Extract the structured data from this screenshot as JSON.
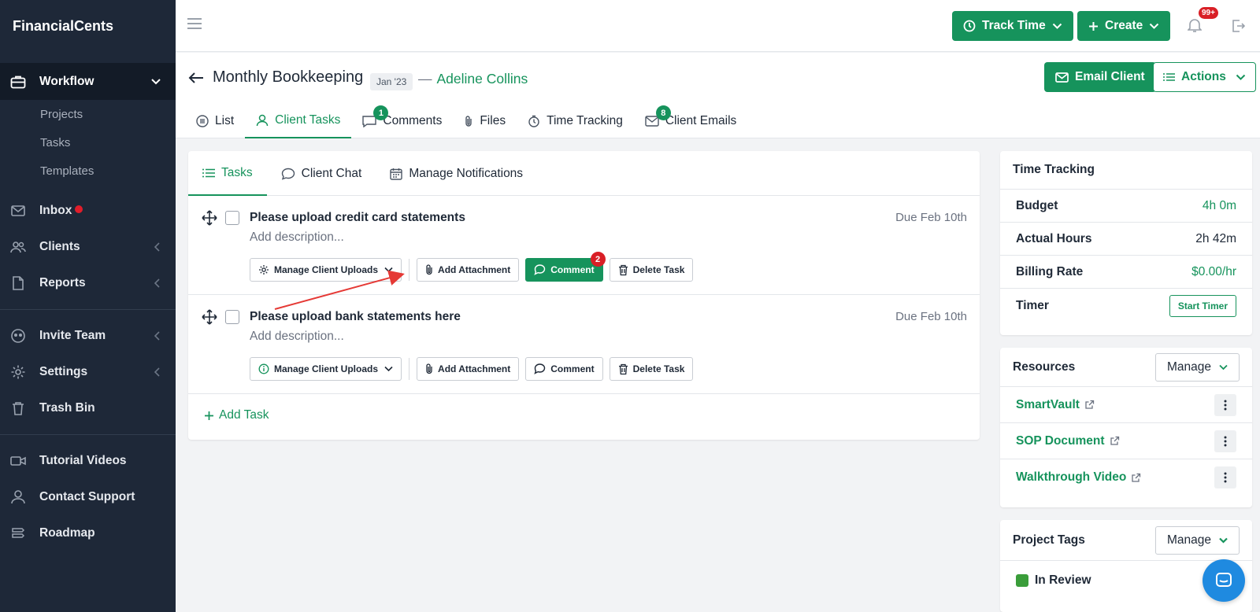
{
  "brand": "FinancialCents",
  "sidebar": {
    "workflow": {
      "label": "Workflow",
      "items": [
        "Projects",
        "Tasks",
        "Templates"
      ]
    },
    "inbox": "Inbox",
    "clients": "Clients",
    "reports": "Reports",
    "invite_team": "Invite Team",
    "settings": "Settings",
    "trash_bin": "Trash Bin",
    "tutorial_videos": "Tutorial Videos",
    "contact_support": "Contact Support",
    "roadmap": "Roadmap"
  },
  "topbar": {
    "track_time": "Track Time",
    "create": "Create",
    "notifications_badge": "99+"
  },
  "project": {
    "title": "Monthly Bookkeeping",
    "period": "Jan '23",
    "dash": "—",
    "client": "Adeline Collins",
    "email_client": "Email Client",
    "actions": "Actions"
  },
  "tabs": [
    {
      "label": "List"
    },
    {
      "label": "Client Tasks"
    },
    {
      "label": "Comments",
      "badge": "1"
    },
    {
      "label": "Files"
    },
    {
      "label": "Time Tracking"
    },
    {
      "label": "Client Emails",
      "badge": "8"
    }
  ],
  "subtabs": [
    "Tasks",
    "Client Chat",
    "Manage Notifications"
  ],
  "tasks": [
    {
      "name": "Please upload credit card statements",
      "description": "Add description...",
      "due": "Due Feb 10th",
      "manage_uploads": "Manage Client Uploads",
      "add_attachment": "Add Attachment",
      "comment": "Comment",
      "comment_badge": "2",
      "delete": "Delete Task"
    },
    {
      "name": "Please upload bank statements here",
      "description": "Add description...",
      "due": "Due Feb 10th",
      "manage_uploads": "Manage Client Uploads",
      "add_attachment": "Add Attachment",
      "comment": "Comment",
      "delete": "Delete Task"
    }
  ],
  "add_task": "Add Task",
  "time_tracking": {
    "title": "Time Tracking",
    "budget_label": "Budget",
    "budget_value": "4h 0m",
    "actual_label": "Actual Hours",
    "actual_value": "2h 42m",
    "rate_label": "Billing Rate",
    "rate_value": "$0.00/hr",
    "timer_label": "Timer",
    "start_timer": "Start Timer"
  },
  "resources": {
    "title": "Resources",
    "manage": "Manage",
    "items": [
      "SmartVault",
      "SOP Document",
      "Walkthrough Video"
    ]
  },
  "project_tags": {
    "title": "Project Tags",
    "manage": "Manage",
    "tag": "In Review",
    "tag_color": "#3a9d3a"
  },
  "colors": {
    "accent": "#16935c",
    "sidebar": "#1e2838",
    "badge_red": "#d91f26"
  }
}
